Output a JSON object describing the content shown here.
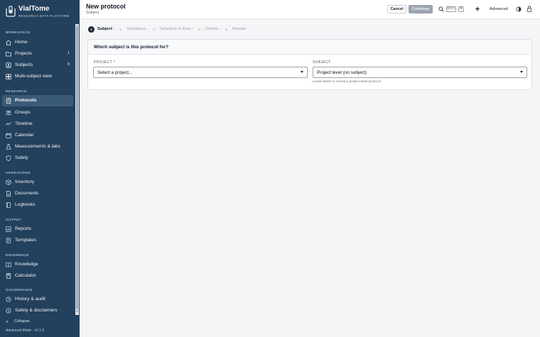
{
  "brand": {
    "name": "VialTome",
    "tagline": "RESEARCH DATA PLATFORM"
  },
  "sidebar": {
    "sections": [
      {
        "label": "WORKSPACE"
      },
      {
        "label": "RESEARCH"
      },
      {
        "label": "OPERATIONS"
      },
      {
        "label": "OUTPUT"
      },
      {
        "label": "REFERENCE"
      },
      {
        "label": "GOVERNANCE"
      }
    ],
    "items": [
      {
        "label": "Home",
        "icon": "home-icon"
      },
      {
        "label": "Projects",
        "icon": "folder-icon",
        "badge": "1"
      },
      {
        "label": "Subjects",
        "icon": "subjects-icon",
        "badge": "8"
      },
      {
        "label": "Multi-subject view",
        "icon": "grid-icon"
      },
      {
        "label": "Protocols",
        "icon": "clipboard-icon",
        "active": true
      },
      {
        "label": "Groups",
        "icon": "groups-icon"
      },
      {
        "label": "Timeline",
        "icon": "timeline-icon"
      },
      {
        "label": "Calendar",
        "icon": "calendar-icon"
      },
      {
        "label": "Measurements & labs",
        "icon": "flask-icon"
      },
      {
        "label": "Safety",
        "icon": "shield-icon"
      },
      {
        "label": "Inventory",
        "icon": "box-icon"
      },
      {
        "label": "Documents",
        "icon": "document-icon"
      },
      {
        "label": "Logbooks",
        "icon": "book-icon"
      },
      {
        "label": "Reports",
        "icon": "chart-icon"
      },
      {
        "label": "Templates",
        "icon": "template-icon"
      },
      {
        "label": "Knowledge",
        "icon": "open-book-icon"
      },
      {
        "label": "Calculator",
        "icon": "calculator-icon"
      },
      {
        "label": "History & audit",
        "icon": "history-icon"
      },
      {
        "label": "Safety & disclaimers",
        "icon": "info-icon"
      }
    ],
    "collapse_label": "Collapse",
    "version": "Advanced Mode · v1.1.0"
  },
  "header": {
    "title": "New protocol",
    "subtitle": "Subject",
    "cancel_label": "Cancel",
    "continue_label": "Continue",
    "shortcut_ctrl": "Ctrl",
    "shortcut_key": "K",
    "advanced_label": "Advanced"
  },
  "stepper": {
    "steps": [
      {
        "num": "1",
        "label": "Subject",
        "active": true
      },
      {
        "num": "2",
        "label": "Substance"
      },
      {
        "num": "3",
        "label": "Schedule & dose"
      },
      {
        "num": "4",
        "label": "Details"
      },
      {
        "num": "5",
        "label": "Review"
      }
    ],
    "separator": "›"
  },
  "form": {
    "question": "Which subject is this protocol for?",
    "project_label": "PROJECT",
    "project_required": "*",
    "project_value": "Select a project...",
    "subject_label": "SUBJECT",
    "subject_value": "Project level (no subject)",
    "subject_help": "Leave blank to record a project-level protocol."
  },
  "colors": {
    "sidebar_bg": "#23405c",
    "active_item_bg": "#3b5a78",
    "continue_disabled": "#9aa4ae",
    "step_active": "#1f2937"
  }
}
